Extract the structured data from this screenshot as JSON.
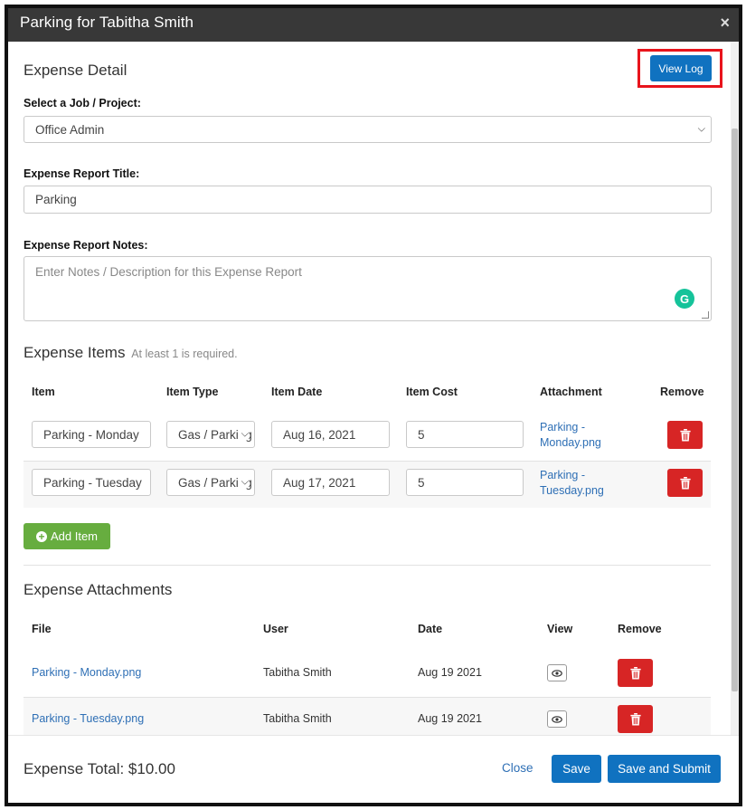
{
  "modal": {
    "title": "Parking for Tabitha Smith",
    "close_icon": "×"
  },
  "expense_detail": {
    "heading": "Expense Detail",
    "view_log_label": "View Log",
    "job_label": "Select a Job / Project:",
    "job_value": "Office Admin",
    "title_label": "Expense Report Title:",
    "title_value": "Parking",
    "notes_label": "Expense Report Notes:",
    "notes_placeholder": "Enter Notes / Description for this Expense Report"
  },
  "expense_items": {
    "heading": "Expense Items",
    "hint": "At least 1 is required.",
    "columns": [
      "Item",
      "Item Type",
      "Item Date",
      "Item Cost",
      "Attachment",
      "Remove"
    ],
    "rows": [
      {
        "item": "Parking - Monday",
        "type": "Gas / Parking",
        "date": "Aug 16, 2021",
        "cost": "5",
        "attachment_line1": "Parking -",
        "attachment_line2": "Monday.png"
      },
      {
        "item": "Parking - Tuesday",
        "type": "Gas / Parking",
        "date": "Aug 17, 2021",
        "cost": "5",
        "attachment_line1": "Parking -",
        "attachment_line2": "Tuesday.png"
      }
    ],
    "add_item_label": "Add Item"
  },
  "attachments": {
    "heading": "Expense Attachments",
    "columns": [
      "File",
      "User",
      "Date",
      "View",
      "Remove"
    ],
    "rows": [
      {
        "file": "Parking - Monday.png",
        "user": "Tabitha Smith",
        "date": "Aug 19 2021"
      },
      {
        "file": "Parking - Tuesday.png",
        "user": "Tabitha Smith",
        "date": "Aug 19 2021"
      }
    ]
  },
  "footer": {
    "total_label": "Expense Total: $10.00",
    "close_label": "Close",
    "save_label": "Save",
    "save_submit_label": "Save and Submit"
  },
  "colors": {
    "primary": "#1072c0",
    "success": "#67ad3f",
    "danger": "#d72525",
    "highlight": "#e8141c",
    "titlebar": "#383838"
  }
}
